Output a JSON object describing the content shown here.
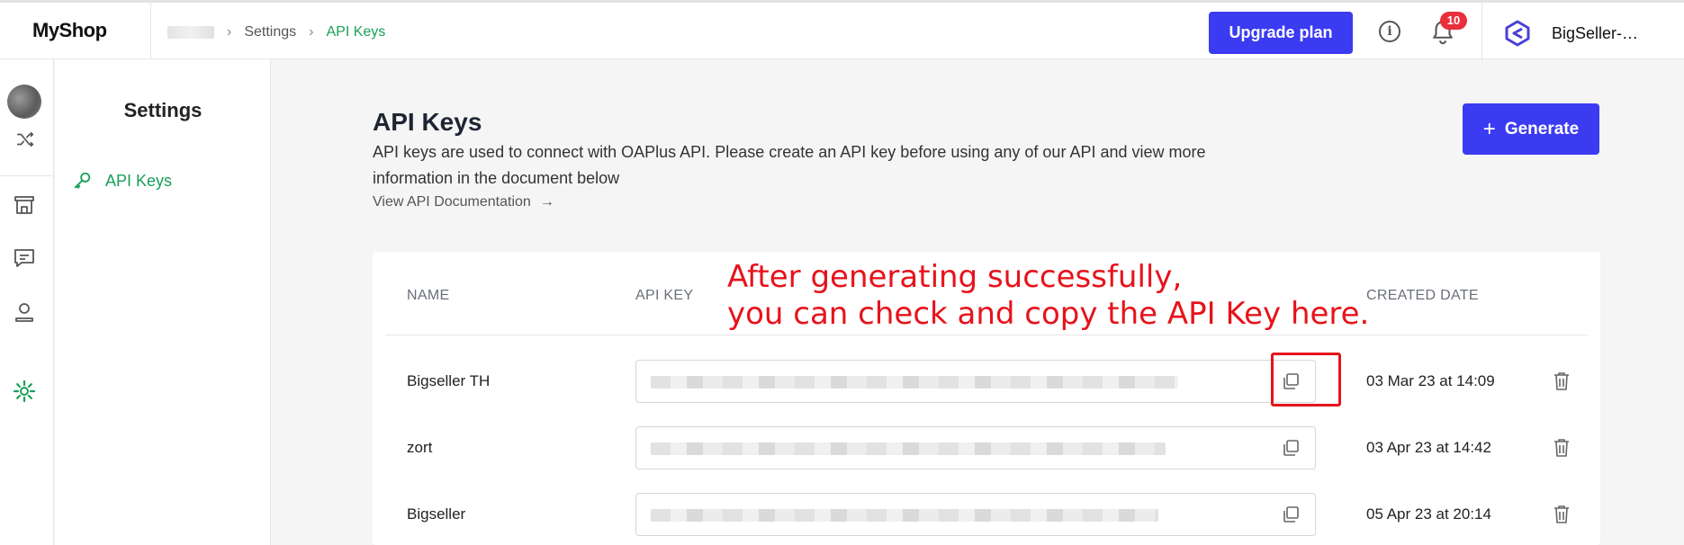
{
  "topbar": {
    "logo": "MyShop",
    "breadcrumb": [
      "Settings",
      "API Keys"
    ],
    "upgrade_label": "Upgrade plan",
    "notification_count": "10",
    "shop_name": "BigSeller-…"
  },
  "sidebar": {
    "title": "Settings",
    "items": [
      {
        "label": "API Keys"
      }
    ]
  },
  "main": {
    "title": "API Keys",
    "description": "API keys are used to connect with OAPlus API. Please create an API key before using any of our API and view more information in the document below",
    "doc_link": "View API Documentation",
    "generate_label": "Generate"
  },
  "table": {
    "columns": [
      "NAME",
      "API KEY",
      "CREATED DATE"
    ],
    "rows": [
      {
        "name": "Bigseller TH",
        "created": "03 Mar 23 at 14:09"
      },
      {
        "name": "zort",
        "created": "03 Apr 23 at 14:42"
      },
      {
        "name": "Bigseller",
        "created": "05 Apr 23 at 20:14"
      }
    ]
  },
  "annotation": {
    "line1": "After generating successfully,",
    "line2": "you can check and copy the API Key here."
  },
  "colors": {
    "primary": "#3b3bf2",
    "accent_green": "#18a058",
    "annotation_red": "#e6131b",
    "badge_red": "#e8303b"
  }
}
